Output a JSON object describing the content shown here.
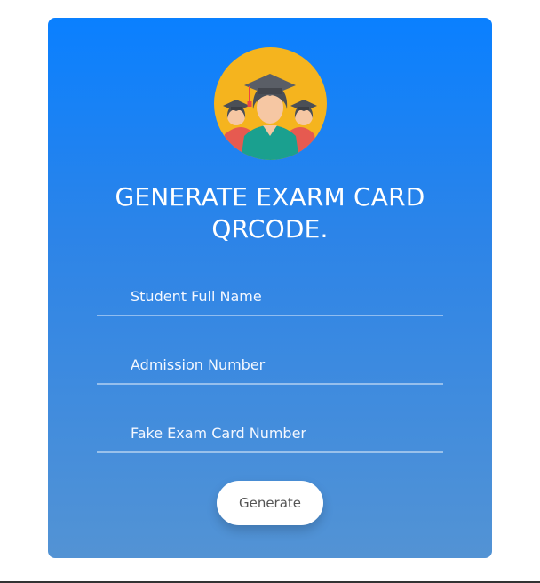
{
  "header": {
    "icon": "graduates-avatar-icon",
    "title_line1": "GENERATE EXARM CARD",
    "title_line2": "QRCODE."
  },
  "form": {
    "fields": [
      {
        "placeholder": "Student Full Name",
        "value": ""
      },
      {
        "placeholder": "Admission Number",
        "value": ""
      },
      {
        "placeholder": "Fake Exam Card Number",
        "value": ""
      }
    ],
    "submit_label": "Generate"
  },
  "colors": {
    "card_gradient_top": "#0a80ff",
    "card_gradient_bottom": "#5393d4",
    "avatar_bg": "#f5b41e",
    "button_bg": "#ffffff",
    "button_text": "#555555"
  }
}
